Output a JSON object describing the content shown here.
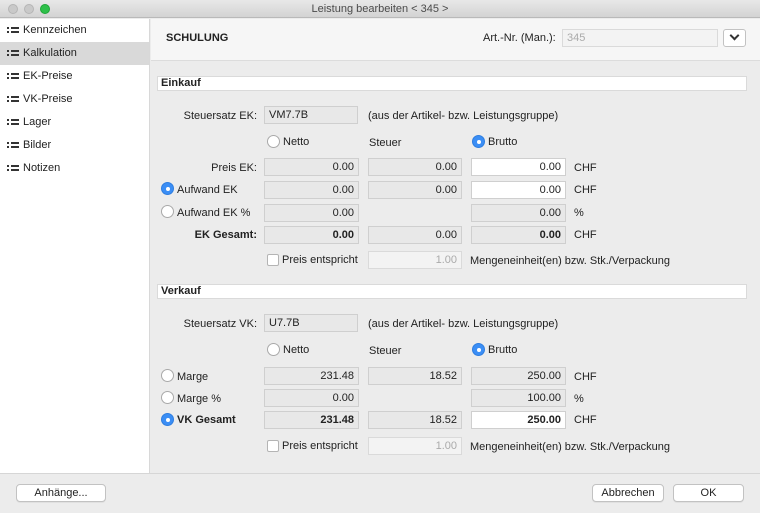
{
  "window": {
    "title": "Leistung bearbeiten < 345 >"
  },
  "sidebar": {
    "items": [
      {
        "label": "Kennzeichen"
      },
      {
        "label": "Kalkulation"
      },
      {
        "label": "EK-Preise"
      },
      {
        "label": "VK-Preise"
      },
      {
        "label": "Lager"
      },
      {
        "label": "Bilder"
      },
      {
        "label": "Notizen"
      }
    ],
    "active_index": 1
  },
  "header": {
    "title": "SCHULUNG",
    "artnr_label": "Art.-Nr. (Man.):",
    "artnr_value": "345"
  },
  "einkauf": {
    "section_title": "Einkauf",
    "steuersatz_label": "Steuersatz EK:",
    "steuersatz_value": "VM7.7B",
    "steuersatz_note": "(aus der Artikel- bzw. Leistungsgruppe)",
    "netto_label": "Netto",
    "steuer_label": "Steuer",
    "brutto_label": "Brutto",
    "basis_selected": "Brutto",
    "rows": {
      "preis": {
        "label": "Preis EK:",
        "netto": "0.00",
        "steuer": "0.00",
        "brutto": "0.00",
        "unit": "CHF"
      },
      "aufwand": {
        "label": "Aufwand EK",
        "netto": "0.00",
        "steuer": "0.00",
        "brutto": "0.00",
        "unit": "CHF"
      },
      "aufwand_pct": {
        "label": "Aufwand EK %",
        "netto": "0.00",
        "brutto": "0.00",
        "unit": "%"
      },
      "gesamt": {
        "label": "EK Gesamt:",
        "netto": "0.00",
        "steuer": "0.00",
        "brutto": "0.00",
        "unit": "CHF"
      }
    },
    "aufwand_selected": "Aufwand EK",
    "preis_entspricht_label": "Preis entspricht",
    "menge_value": "1.00",
    "menge_label": "Mengeneinheit(en) bzw. Stk./Verpackung"
  },
  "verkauf": {
    "section_title": "Verkauf",
    "steuersatz_label": "Steuersatz VK:",
    "steuersatz_value": "U7.7B",
    "steuersatz_note": "(aus der Artikel- bzw. Leistungsgruppe)",
    "netto_label": "Netto",
    "steuer_label": "Steuer",
    "brutto_label": "Brutto",
    "basis_selected": "Brutto",
    "rows": {
      "marge": {
        "label": "Marge",
        "netto": "231.48",
        "steuer": "18.52",
        "brutto": "250.00",
        "unit": "CHF"
      },
      "marge_pct": {
        "label": "Marge %",
        "netto": "0.00",
        "brutto": "100.00",
        "unit": "%"
      },
      "gesamt": {
        "label": "VK Gesamt",
        "netto": "231.48",
        "steuer": "18.52",
        "brutto": "250.00",
        "unit": "CHF"
      }
    },
    "mode_selected": "VK Gesamt",
    "preis_entspricht_label": "Preis entspricht",
    "menge_value": "1.00",
    "menge_label": "Mengeneinheit(en) bzw. Stk./Verpackung"
  },
  "footer": {
    "attachments_label": "Anhänge...",
    "cancel_label": "Abbrechen",
    "ok_label": "OK"
  },
  "colors": {
    "accent": "#3b8ef5",
    "close_green": "#2ec04a"
  }
}
